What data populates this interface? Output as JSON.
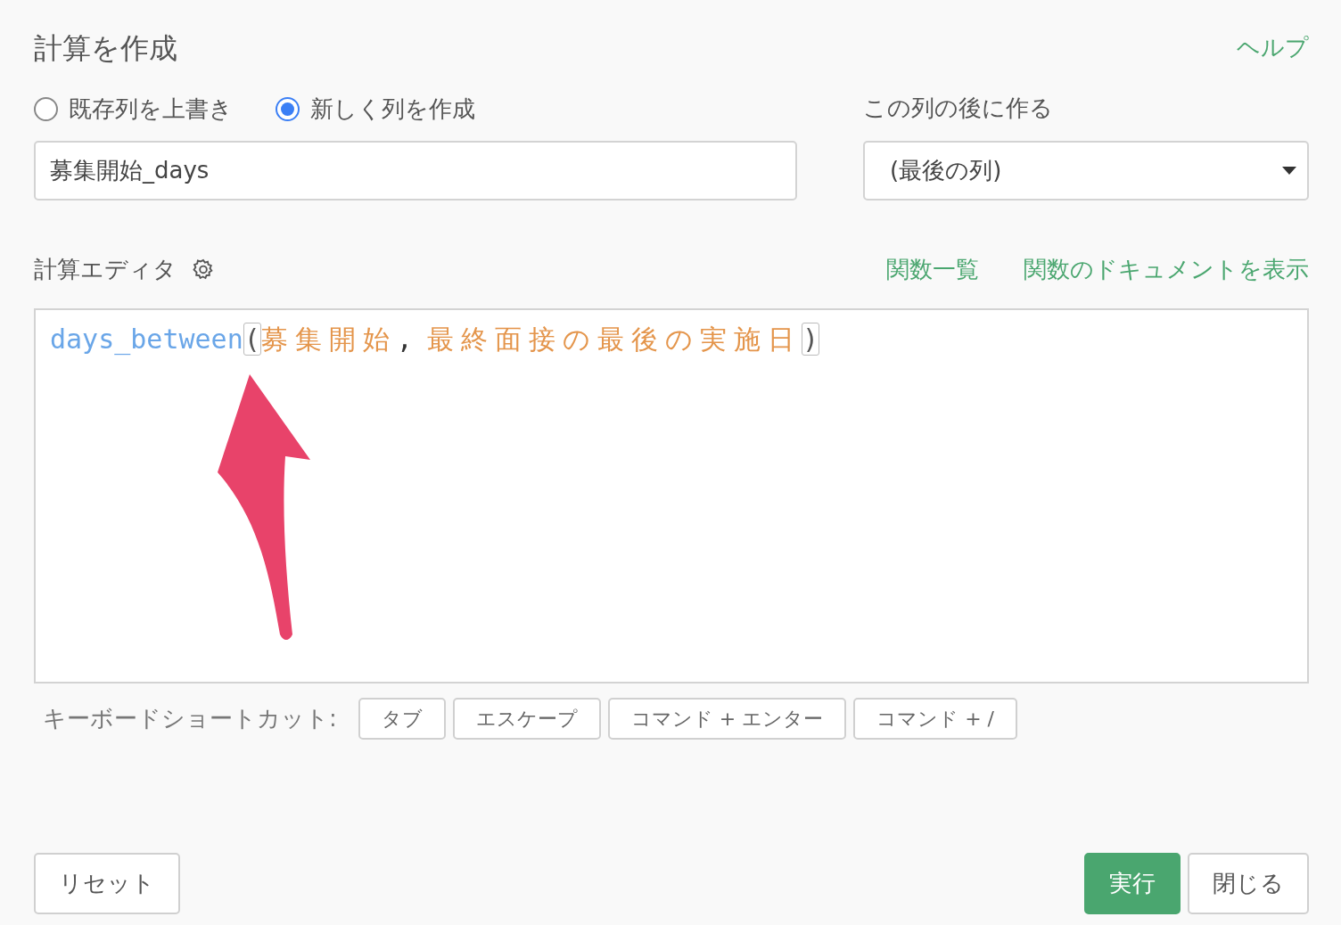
{
  "title": "計算を作成",
  "help_link": "ヘルプ",
  "modes": [
    {
      "label": "既存列を上書き",
      "selected": false
    },
    {
      "label": "新しく列を作成",
      "selected": true
    }
  ],
  "column_name": {
    "value": "募集開始_days"
  },
  "position": {
    "label": "この列の後に作る",
    "value": "(最後の列)"
  },
  "editor": {
    "label": "計算エディタ",
    "links": [
      "関数一覧",
      "関数のドキュメントを表示"
    ],
    "tokens": [
      {
        "kind": "function",
        "text": "days_between"
      },
      {
        "kind": "bracket",
        "text": "("
      },
      {
        "kind": "column",
        "text": "募集開始"
      },
      {
        "kind": "punct",
        "text": ","
      },
      {
        "kind": "column",
        "text": "最終面接の最後の実施日"
      },
      {
        "kind": "bracket",
        "text": ")"
      }
    ]
  },
  "shortcuts": {
    "label": "キーボードショートカット:",
    "keys": [
      "タブ",
      "エスケープ",
      "コマンド + エンター",
      "コマンド + /"
    ]
  },
  "buttons": [
    {
      "label": "リセット",
      "kind": "secondary"
    },
    {
      "label": "実行",
      "kind": "primary"
    },
    {
      "label": "閉じる",
      "kind": "secondary"
    }
  ]
}
